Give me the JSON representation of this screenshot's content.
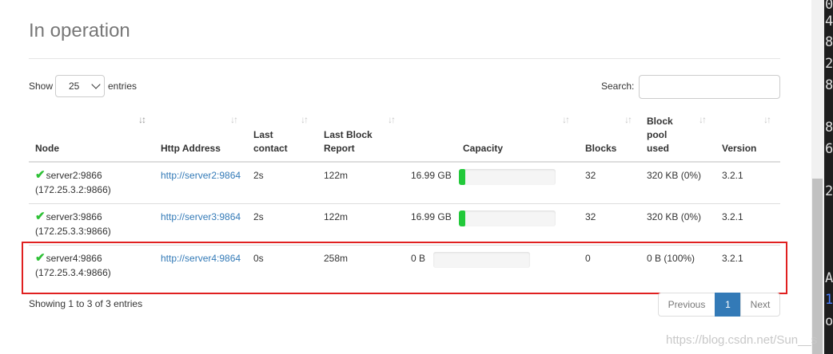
{
  "section_title": "In operation",
  "controls": {
    "show_label": "Show",
    "page_length": "25",
    "entries_label": "entries",
    "search_label": "Search:",
    "search_value": ""
  },
  "columns": {
    "node": "Node",
    "http_address": "Http Address",
    "last_contact_1": "Last",
    "last_contact_2": "contact",
    "last_block_1": "Last Block",
    "last_block_2": "Report",
    "capacity": "Capacity",
    "blocks": "Blocks",
    "pool_1": "Block",
    "pool_2": "pool",
    "pool_3": "used",
    "version": "Version"
  },
  "rows": [
    {
      "node": "server2:9866",
      "node_ip": "(172.25.3.2:9866)",
      "http": "http://server2:9864",
      "last_contact": "2s",
      "last_block": "122m",
      "capacity": "16.99 GB",
      "capacity_used_pct": 7,
      "blocks": "32",
      "pool": "320 KB (0%)",
      "version": "3.2.1"
    },
    {
      "node": "server3:9866",
      "node_ip": "(172.25.3.3:9866)",
      "http": "http://server3:9864",
      "last_contact": "2s",
      "last_block": "122m",
      "capacity": "16.99 GB",
      "capacity_used_pct": 7,
      "blocks": "32",
      "pool": "320 KB (0%)",
      "version": "3.2.1"
    },
    {
      "node": "server4:9866",
      "node_ip": "(172.25.3.4:9866)",
      "http": "http://server4:9864",
      "last_contact": "0s",
      "last_block": "258m",
      "capacity": "0 B",
      "capacity_used_pct": 0,
      "blocks": "0",
      "pool": "0 B (100%)",
      "version": "3.2.1"
    }
  ],
  "footer": {
    "info": "Showing 1 to 3 of 3 entries",
    "prev": "Previous",
    "page": "1",
    "next": "Next"
  },
  "watermark": "https://blog.csdn.net/Sun__s",
  "terminal_chars": [
    "0",
    "4",
    "8",
    "2",
    "8",
    "",
    "8",
    "6",
    "",
    "2",
    "",
    "",
    "",
    "",
    "A",
    "1",
    "o"
  ],
  "colors": {
    "link": "#337ab7",
    "check": "#2ec136",
    "bar_fill": "#22c93a",
    "highlight": "#e02020",
    "active_page": "#337ab7"
  }
}
